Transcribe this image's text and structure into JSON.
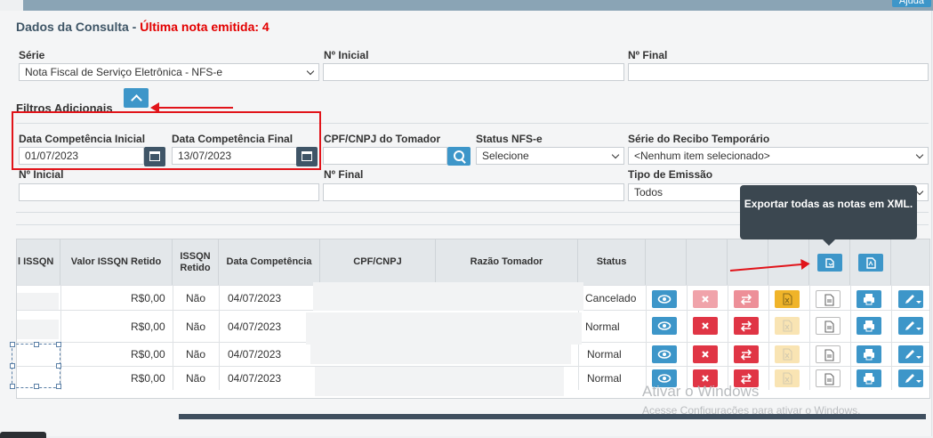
{
  "header": {
    "title": "Dados da Consulta",
    "title_sep": " - ",
    "last_note": "Última nota emitida: 4",
    "help_label": "Ajuda"
  },
  "form": {
    "serie_label": "Série",
    "serie_value": "Nota Fiscal de Serviço Eletrônica - NFS-e",
    "n_inicial_label": "Nº Inicial",
    "n_inicial_value": "",
    "n_final_label": "Nº Final",
    "n_final_value": ""
  },
  "filters": {
    "title": "Filtros Adicionais",
    "dc_inicial_label": "Data Competência Inicial",
    "dc_inicial_value": "01/07/2023",
    "dc_final_label": "Data Competência Final",
    "dc_final_value": "13/07/2023",
    "cpf_label": "CPF/CNPJ do Tomador",
    "cpf_value": "",
    "status_label": "Status NFS-e",
    "status_value": "Selecione",
    "serie_recibo_label": "Série do Recibo Temporário",
    "serie_recibo_value": "<Nenhum item selecionado>",
    "n_inicial_label": "Nº Inicial",
    "n_final_label": "Nº Final",
    "tipo_emissao_label": "Tipo de Emissão",
    "tipo_emissao_value": "Todos"
  },
  "tooltip": "Exportar todas as notas em XML.",
  "table": {
    "columns": [
      "l ISSQN",
      "Valor  ISSQN Retido",
      "ISSQN Retido",
      "Data Competência",
      "CPF/CNPJ",
      "Razão Tomador",
      "Status"
    ],
    "rows": [
      {
        "issqn": "",
        "valor": "R$0,00",
        "retido": "Não",
        "data": "04/07/2023",
        "cpf": "",
        "razao": "",
        "status": "Cancelado"
      },
      {
        "issqn": "",
        "valor": "R$0,00",
        "retido": "Não",
        "data": "04/07/2023",
        "cpf": "",
        "razao": "",
        "status": "Normal"
      },
      {
        "issqn": "",
        "valor": "R$0,00",
        "retido": "Não",
        "data": "04/07/2023",
        "cpf": "",
        "razao": "",
        "status": "Normal"
      },
      {
        "issqn": "",
        "valor": "R$0,00",
        "retido": "Não",
        "data": "04/07/2023",
        "cpf": "",
        "razao": "",
        "status": "Normal"
      }
    ]
  },
  "watermark": {
    "line1": "Ativar o Windows",
    "line2": "Acesse Configurações para ativar o Windows."
  },
  "colors": {
    "accent": "#3d96c9",
    "danger": "#e03545",
    "warning": "#f0b429",
    "title_red": "#e30000"
  }
}
